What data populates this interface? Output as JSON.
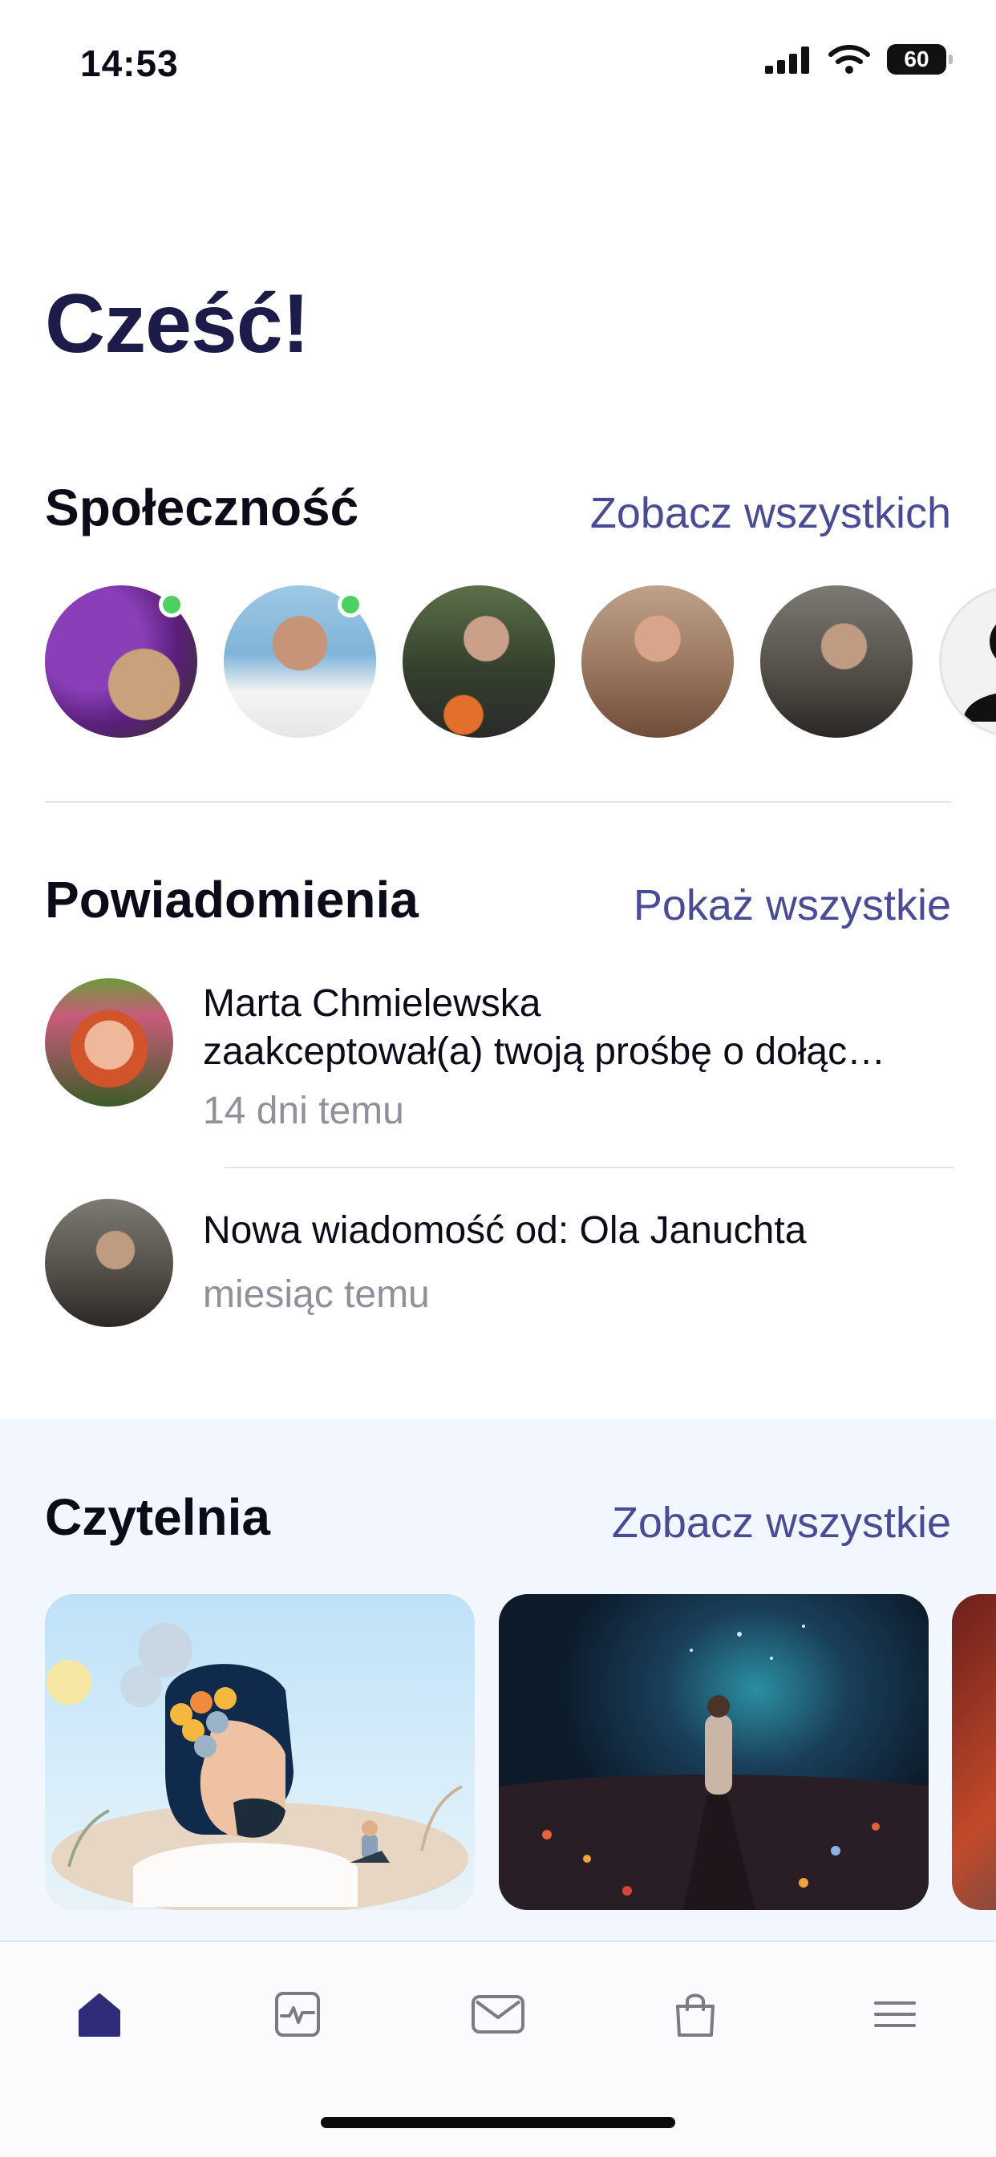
{
  "status_bar": {
    "time": "14:53",
    "battery": "60"
  },
  "greeting": "Cześć!",
  "community": {
    "title": "Społeczność",
    "link": "Zobacz wszystkich",
    "members": [
      {
        "online": true
      },
      {
        "online": true
      },
      {
        "online": false
      },
      {
        "online": false
      },
      {
        "online": false
      },
      {
        "online": false,
        "placeholder": true
      }
    ]
  },
  "notifications": {
    "title": "Powiadomienia",
    "link": "Pokaż wszystkie",
    "items": [
      {
        "line1": "Marta Chmielewska",
        "line2": "zaakceptował(a) twoją prośbę o dołąc…",
        "time": "14 dni temu"
      },
      {
        "line1": "Nowa wiadomość od: Ola Januchta",
        "time": "miesiąc temu"
      }
    ]
  },
  "reading": {
    "title": "Czytelnia",
    "link": "Zobacz wszystkie"
  },
  "bottom_nav": {
    "items": [
      {
        "icon": "home-icon",
        "active": true
      },
      {
        "icon": "activity-icon",
        "active": false
      },
      {
        "icon": "mail-icon",
        "active": false
      },
      {
        "icon": "shopping-bag-icon",
        "active": false
      },
      {
        "icon": "menu-icon",
        "active": false
      }
    ]
  },
  "colors": {
    "title_dark": "#1d1b4a",
    "link": "#4a4b97",
    "online": "#4cd05f",
    "muted": "#8f9099",
    "reading_bg": "#f2f6fe",
    "nav_active": "#2f2d7a",
    "nav_inactive": "#7a7b85"
  }
}
